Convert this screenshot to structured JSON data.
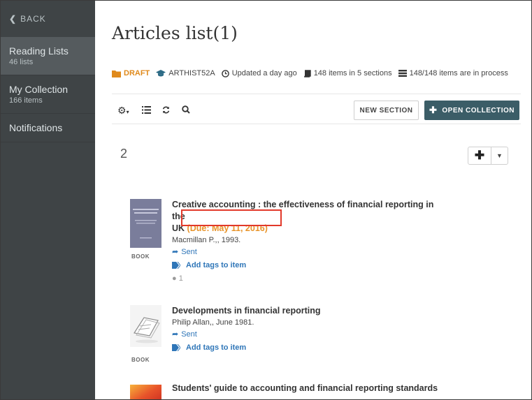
{
  "sidebar": {
    "back_label": "BACK",
    "items": [
      {
        "title": "Reading Lists",
        "sub": "46 lists"
      },
      {
        "title": "My Collection",
        "sub": "166 items"
      },
      {
        "title": "Notifications",
        "sub": ""
      }
    ]
  },
  "page": {
    "title": "Articles list(1)"
  },
  "meta": {
    "status": "DRAFT",
    "course": "ARTHIST52A",
    "updated": "Updated a day ago",
    "items_sections": "148 items in 5 sections",
    "in_process": "148/148 items are in process"
  },
  "toolbar": {
    "new_section": "NEW SECTION",
    "open_collection": "OPEN COLLECTION"
  },
  "section": {
    "number": "2"
  },
  "items": [
    {
      "title_line1": "Creative accounting : the effectiveness of financial reporting in the",
      "title_line2": "UK",
      "due": "(Due:  May 11, 2016)",
      "publisher": "Macmillan P.,, 1993.",
      "sent": "Sent",
      "tag": "Add tags to item",
      "comments": "1",
      "type": "BOOK"
    },
    {
      "title": "Developments in financial reporting",
      "publisher": "Philip Allan,, June 1981.",
      "sent": "Sent",
      "tag": "Add tags to item",
      "type": "BOOK"
    },
    {
      "title": "Students' guide to accounting and financial reporting standards"
    }
  ],
  "colors": {
    "sidebar": "#3f4446",
    "primary_button": "#3b5d67",
    "draft": "#e08a1c",
    "link": "#2f76b8",
    "due": "#e8942a",
    "highlight": "#e2392a"
  }
}
